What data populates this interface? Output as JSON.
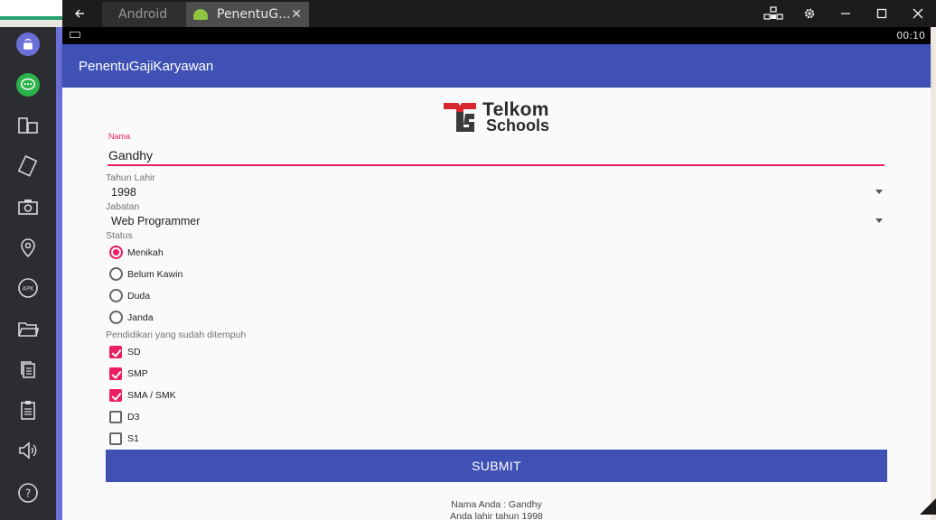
{
  "window": {
    "tabs": [
      {
        "label": "Android"
      },
      {
        "label": "PenentuG..."
      }
    ],
    "close_glyph": "✕"
  },
  "statusbar": {
    "time": "00:10"
  },
  "app": {
    "title": "PenentuGajiKaryawan"
  },
  "logo": {
    "line1": "Telkom",
    "line2": "Schools",
    "colors": {
      "red": "#d8262f",
      "dark": "#3a3a3a"
    }
  },
  "form": {
    "nama": {
      "label": "Nama",
      "value": "Gandhy"
    },
    "tahun_lahir": {
      "label": "Tahun Lahir",
      "value": "1998"
    },
    "jabatan": {
      "label": "Jabatan",
      "value": "Web Programmer"
    },
    "status": {
      "label": "Status",
      "options": [
        {
          "label": "Menikah",
          "checked": true
        },
        {
          "label": "Belum Kawin",
          "checked": false
        },
        {
          "label": "Duda",
          "checked": false
        },
        {
          "label": "Janda",
          "checked": false
        }
      ]
    },
    "pendidikan": {
      "label": "Pendidikan yang sudah ditempuh",
      "options": [
        {
          "label": "SD",
          "checked": true
        },
        {
          "label": "SMP",
          "checked": true
        },
        {
          "label": "SMA / SMK",
          "checked": true
        },
        {
          "label": "D3",
          "checked": false
        },
        {
          "label": "S1",
          "checked": false
        }
      ]
    },
    "submit_label": "SUBMIT"
  },
  "result": {
    "line1": "Nama Anda : Gandhy",
    "line2": "Anda lahir tahun 1998"
  },
  "colors": {
    "primary": "#3f51b5",
    "accent": "#e91e63",
    "sidebar": "#2c2d33"
  },
  "sidebar_icons": [
    "screen-record-icon",
    "chat-icon",
    "multi-instance-icon",
    "rotate-icon",
    "screenshot-icon",
    "location-icon",
    "apk-icon",
    "folder-icon",
    "copy-icon",
    "paste-icon",
    "volume-icon",
    "help-icon"
  ]
}
